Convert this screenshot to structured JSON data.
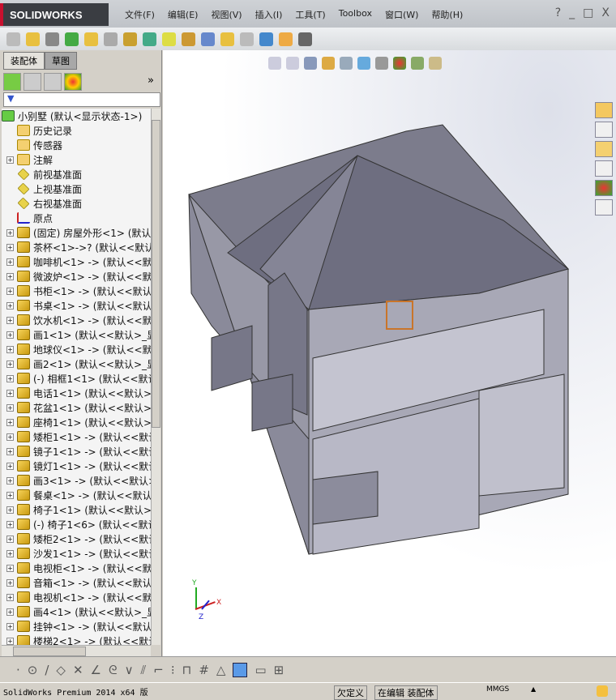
{
  "app": {
    "logo": "SOLIDWORKS"
  },
  "menu": [
    "文件(F)",
    "编辑(E)",
    "视图(V)",
    "插入(I)",
    "工具(T)",
    "Toolbox",
    "窗口(W)",
    "帮助(H)"
  ],
  "window_controls": [
    "?",
    "_",
    "□",
    "X"
  ],
  "tabs": [
    "装配体",
    "草图"
  ],
  "more_label": "»",
  "filter_icon": "▼",
  "tree": [
    {
      "label": "小别墅  (默认<显示状态-1>)",
      "icon": "assembly",
      "exp": ""
    },
    {
      "label": "历史记录",
      "icon": "history",
      "exp": ""
    },
    {
      "label": "传感器",
      "icon": "sensor",
      "exp": ""
    },
    {
      "label": "注解",
      "icon": "annotation",
      "exp": "+"
    },
    {
      "label": "前视基准面",
      "icon": "plane",
      "exp": ""
    },
    {
      "label": "上视基准面",
      "icon": "plane",
      "exp": ""
    },
    {
      "label": "右视基准面",
      "icon": "plane",
      "exp": ""
    },
    {
      "label": "原点",
      "icon": "origin",
      "exp": ""
    },
    {
      "label": "(固定) 房屋外形<1> (默认",
      "icon": "comp",
      "exp": "+"
    },
    {
      "label": "茶杯<1>->? (默认<<默认>_",
      "icon": "comp",
      "exp": "+"
    },
    {
      "label": "咖啡机<1> -> (默认<<默认",
      "icon": "comp",
      "exp": "+"
    },
    {
      "label": "微波炉<1> -> (默认<<默认",
      "icon": "comp",
      "exp": "+"
    },
    {
      "label": "书柜<1> -> (默认<<默认>_",
      "icon": "comp",
      "exp": "+"
    },
    {
      "label": "书桌<1> -> (默认<<默认>_",
      "icon": "comp",
      "exp": "+"
    },
    {
      "label": "饮水机<1> -> (默认<<默认",
      "icon": "comp",
      "exp": "+"
    },
    {
      "label": "画1<1> (默认<<默认>_显示",
      "icon": "comp",
      "exp": "+"
    },
    {
      "label": "地球仪<1> -> (默认<<默认",
      "icon": "comp",
      "exp": "+"
    },
    {
      "label": "画2<1> (默认<<默认>_显示",
      "icon": "comp",
      "exp": "+"
    },
    {
      "label": "(-) 相框1<1> (默认<<默认",
      "icon": "comp",
      "exp": "+"
    },
    {
      "label": "电话1<1> (默认<<默认>_显",
      "icon": "comp",
      "exp": "+"
    },
    {
      "label": "花盆1<1> (默认<<默认>_显",
      "icon": "comp",
      "exp": "+"
    },
    {
      "label": "座椅1<1> (默认<<默认>_显",
      "icon": "comp",
      "exp": "+"
    },
    {
      "label": "矮柜1<1> -> (默认<<默认>",
      "icon": "comp",
      "exp": "+"
    },
    {
      "label": "镜子1<1> -> (默认<<默认>",
      "icon": "comp",
      "exp": "+"
    },
    {
      "label": "镜灯1<1> -> (默认<<默认>",
      "icon": "comp",
      "exp": "+"
    },
    {
      "label": "画3<1> -> (默认<<默认>_显",
      "icon": "comp",
      "exp": "+"
    },
    {
      "label": "餐桌<1> -> (默认<<默认>_",
      "icon": "comp",
      "exp": "+"
    },
    {
      "label": "椅子1<1> (默认<<默认>_显",
      "icon": "comp",
      "exp": "+"
    },
    {
      "label": "(-) 椅子1<6> (默认<<默认",
      "icon": "comp",
      "exp": "+"
    },
    {
      "label": "矮柜2<1> -> (默认<<默认>",
      "icon": "comp",
      "exp": "+"
    },
    {
      "label": "沙发1<1> -> (默认<<默认>",
      "icon": "comp",
      "exp": "+"
    },
    {
      "label": "电视柜<1> -> (默认<<默认",
      "icon": "comp",
      "exp": "+"
    },
    {
      "label": "音箱<1> -> (默认<<默认>_",
      "icon": "comp",
      "exp": "+"
    },
    {
      "label": "电视机<1> -> (默认<<默认",
      "icon": "comp",
      "exp": "+"
    },
    {
      "label": "画4<1> (默认<<默认>_显示",
      "icon": "comp",
      "exp": "+"
    },
    {
      "label": "挂钟<1> -> (默认<<默认>_",
      "icon": "comp",
      "exp": "+"
    },
    {
      "label": "楼梯2<1> -> (默认<<默认>",
      "icon": "comp",
      "exp": "+"
    }
  ],
  "triad": {
    "x": "X",
    "y": "Y",
    "z": "Z"
  },
  "status": {
    "product": "SolidWorks Premium 2014 x64 版",
    "definition": "欠定义",
    "mode": "在编辑 装配体",
    "units": "MMGS",
    "arrow": "▲"
  },
  "colors": {
    "brand": "#c8102e",
    "model": "#8e8e9a"
  }
}
